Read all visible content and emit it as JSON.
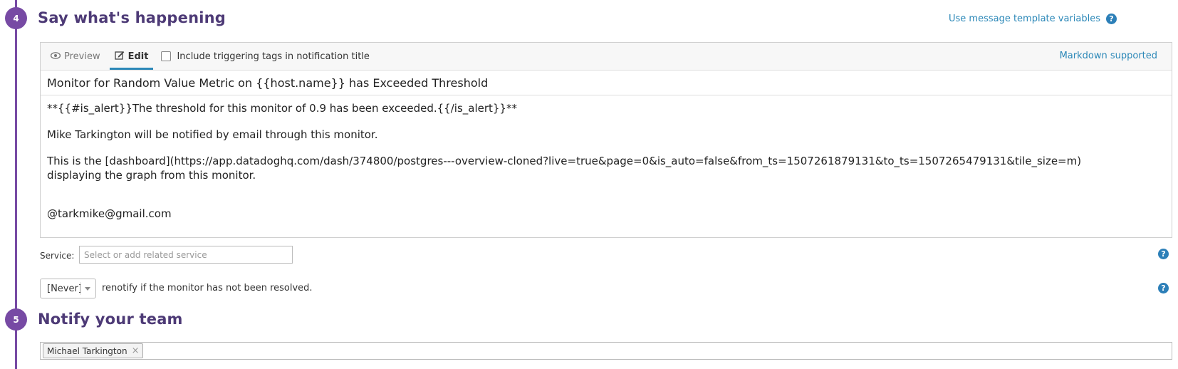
{
  "steps": {
    "say": {
      "number": "4",
      "title": "Say what's happening"
    },
    "notify": {
      "number": "5",
      "title": "Notify your team"
    }
  },
  "template_link": "Use message template variables",
  "editor": {
    "tabs": [
      {
        "label": "Preview",
        "icon": "eye-icon"
      },
      {
        "label": "Edit",
        "icon": "edit-icon",
        "active": true
      }
    ],
    "include_tags_label": "Include triggering tags in notification title",
    "include_tags_checked": false,
    "markdown_note": "Markdown supported",
    "title": "Monitor for Random Value Metric on {{host.name}} has Exceeded Threshold",
    "body": {
      "line1": "**{{#is_alert}}The threshold for this monitor of 0.9 has been exceeded.{{/is_alert}}**",
      "line2": "Mike Tarkington will be notified by email through this monitor.",
      "line3a": "This is the [dashboard](https://app.datadoghq.com/dash/374800/postgres---overview-cloned?live=true&page=0&is_auto=false&from_ts=1507261879131&to_ts=1507265479131&tile_size=m)",
      "line3b": "displaying the graph from this monitor.",
      "line4": "@tarkmike@gmail.com"
    }
  },
  "service": {
    "label": "Service:",
    "placeholder": "Select or add related service"
  },
  "renotify": {
    "selected": "[Never]",
    "text": "renotify if the monitor has not been resolved."
  },
  "team": {
    "tags": [
      "Michael Tarkington"
    ]
  },
  "colors": {
    "accent_purple": "#774aa4",
    "title_purple": "#4d3a76",
    "link_blue": "#2c88b8"
  }
}
